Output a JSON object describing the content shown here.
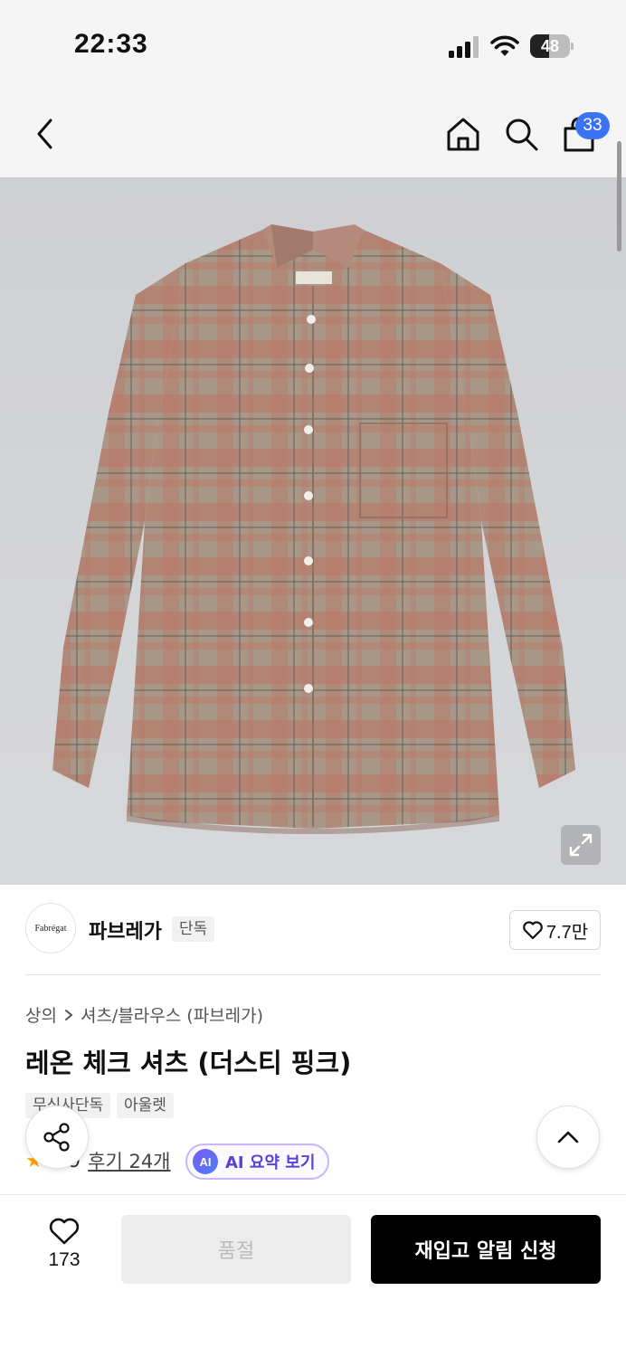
{
  "status_bar": {
    "time": "22:33",
    "battery": "48",
    "battery_level": 0.48
  },
  "header": {
    "cart_count": "33"
  },
  "brand": {
    "logo_text": "Fabrégat",
    "name": "파브레가",
    "exclusive_tag": "단독",
    "like_count": "7.7만"
  },
  "breadcrumb": {
    "category": "상의",
    "subcategory": "셔츠/블라우스 (파브레가)"
  },
  "product": {
    "title": "레온 체크 셔츠 (더스티 핑크)",
    "tags": [
      "무신사단독",
      "아울렛"
    ],
    "rating": "4.9",
    "review_link": "후기 24개",
    "ai_badge": "AI",
    "ai_summary": "AI 요약 보기"
  },
  "bottom_bar": {
    "wish_count": "173",
    "sold_out_label": "품절",
    "restock_label": "재입고 알림 신청"
  },
  "icons": [
    "back-arrow-icon",
    "home-icon",
    "search-icon",
    "shopping-bag-icon",
    "expand-icon",
    "heart-icon",
    "share-icon",
    "chevron-up-icon",
    "star-icon"
  ],
  "colors": {
    "cart_badge": "#3b74f2",
    "ai_accent": "#5b3fd6",
    "restock_button": "#000000",
    "rating_star": "#ffa500"
  }
}
